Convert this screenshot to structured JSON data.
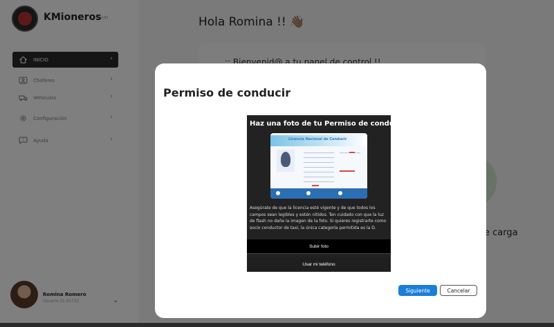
{
  "app": {
    "brand": "KMioneros",
    "version": "v.01"
  },
  "sidebar": {
    "items": [
      {
        "label": "INICIO",
        "icon": "home-icon",
        "active": true
      },
      {
        "label": "Choferes",
        "icon": "id-card-icon"
      },
      {
        "label": "Vehiculos",
        "icon": "truck-icon"
      },
      {
        "label": "Configuración",
        "icon": "gear-icon"
      },
      {
        "label": "Ayuda",
        "icon": "help-chat-icon"
      }
    ]
  },
  "user": {
    "name": "Romina Romero",
    "id_label": "Usuario ID 25732"
  },
  "main": {
    "greeting": "Hola Romina !! 👋🏽",
    "welcome": ":: Bienvenid@ a tu panel de control !!",
    "partial_text": "e carga"
  },
  "modal": {
    "title": "Permiso de conducir",
    "photo_heading": "Haz una foto de tu Permiso de conducir",
    "license_title": "Licencia Nacional de Conducir",
    "description": "Asegúrate de que la licencia esté vigente y de que todos los campos sean legibles y estén nítidos. Ten cuidado con que la luz de flash no dañe la imagen de la foto. Si quieres registrarte como socio conductor de taxi, la única categoría permitida es la D.",
    "upload_label": "Subir foto",
    "phone_label": "Usar mi teléfono",
    "next_label": "Siguiente",
    "cancel_label": "Cancelar"
  },
  "colors": {
    "primary_button": "#1a7fd6",
    "active_nav": "#2b2b2b",
    "license_blue": "#2c6eb3"
  }
}
